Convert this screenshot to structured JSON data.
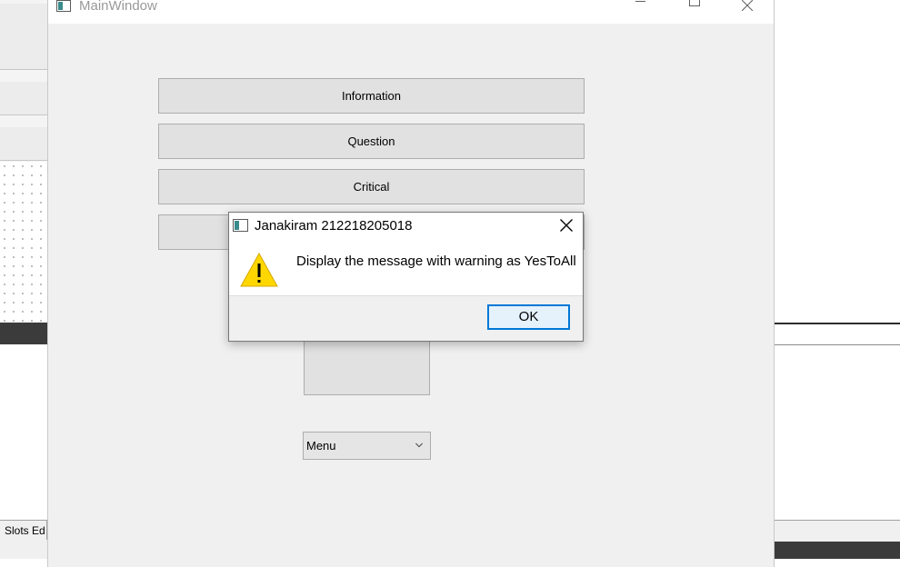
{
  "main_window": {
    "title": "MainWindow",
    "buttons": {
      "information": "Information",
      "question": "Question",
      "critical": "Critical",
      "warning": "",
      "square": ""
    },
    "combo": {
      "selected": "Menu"
    }
  },
  "dialog": {
    "title": "Janakiram 212218205018",
    "message": "Display the message with warning as YesToAll",
    "ok_label": "OK",
    "icon": "warning-icon"
  },
  "background": {
    "slots_tab_label": "Slots Ed"
  },
  "colors": {
    "accent": "#0078d7",
    "warning": "#ffd700",
    "app_icon": "#3a8b8b"
  }
}
